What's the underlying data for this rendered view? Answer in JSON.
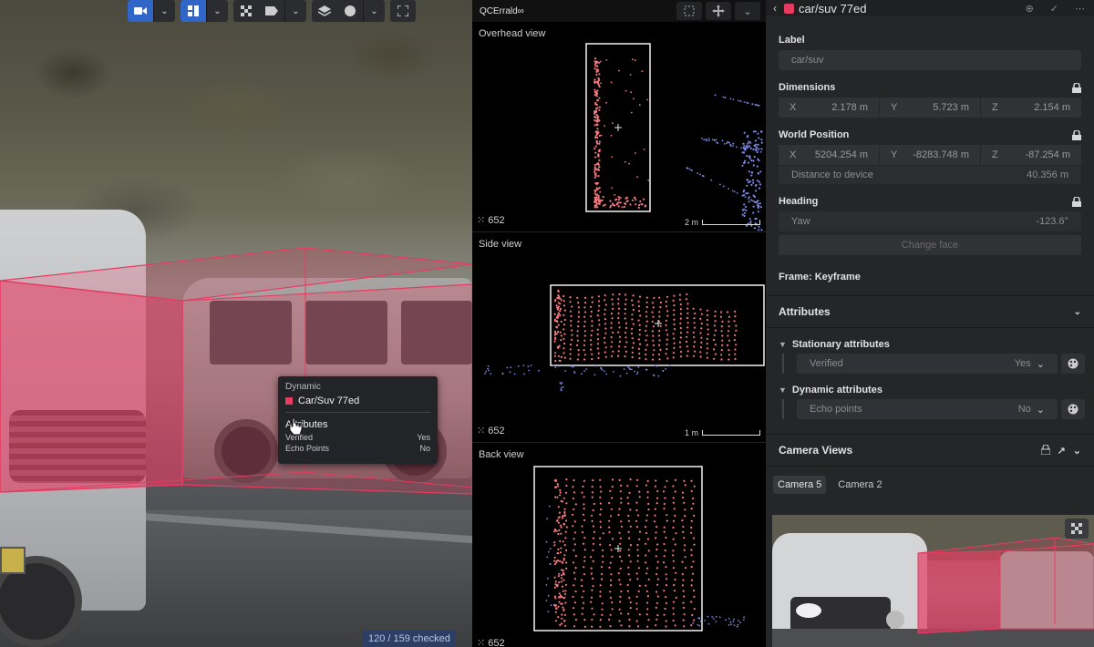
{
  "toolbar": {
    "camera_icon": "video-camera-icon",
    "layout_icon": "grid-layout-icon"
  },
  "tooltip": {
    "type": "Dynamic",
    "object": "Car/Suv 77ed",
    "attributes_title": "Attributes",
    "rows": [
      {
        "key": "Verified",
        "value": "Yes"
      },
      {
        "key": "Echo Points",
        "value": "No"
      }
    ]
  },
  "status": {
    "checked": "120 / 159 checked"
  },
  "lidar": {
    "title": "QCErrald∞",
    "panels": [
      {
        "title": "Overhead view",
        "count": "652",
        "scale": "2 m"
      },
      {
        "title": "Side view",
        "count": "652",
        "scale": "1 m"
      },
      {
        "title": "Back view",
        "count": "652",
        "scale": ""
      }
    ]
  },
  "props": {
    "title": "car/suv 77ed",
    "label_title": "Label",
    "label_value": "car/suv",
    "dimensions_title": "Dimensions",
    "dimensions": [
      {
        "axis": "X",
        "value": "2.178 m"
      },
      {
        "axis": "Y",
        "value": "5.723 m"
      },
      {
        "axis": "Z",
        "value": "2.154 m"
      }
    ],
    "world_title": "World Position",
    "world": [
      {
        "axis": "X",
        "value": "5204.254 m"
      },
      {
        "axis": "Y",
        "value": "-8283.748 m"
      },
      {
        "axis": "Z",
        "value": "-87.254 m"
      }
    ],
    "distance_label": "Distance to device",
    "distance_value": "40.356 m",
    "heading_title": "Heading",
    "yaw_label": "Yaw",
    "yaw_value": "-123.6°",
    "change_face": "Change face",
    "frame": "Frame: Keyframe",
    "attributes_section": "Attributes",
    "stationary_title": "Stationary attributes",
    "verified_label": "Verified",
    "verified_value": "Yes",
    "dynamic_title": "Dynamic attributes",
    "echo_label": "Echo points",
    "echo_value": "No",
    "camera_section": "Camera Views",
    "camera_tabs": [
      "Camera 5",
      "Camera 2"
    ]
  },
  "colors": {
    "accent": "#e63c62",
    "lidar_red": "#f27a7e",
    "lidar_blue": "#7d88e0",
    "active_blue": "#2f66c8"
  }
}
